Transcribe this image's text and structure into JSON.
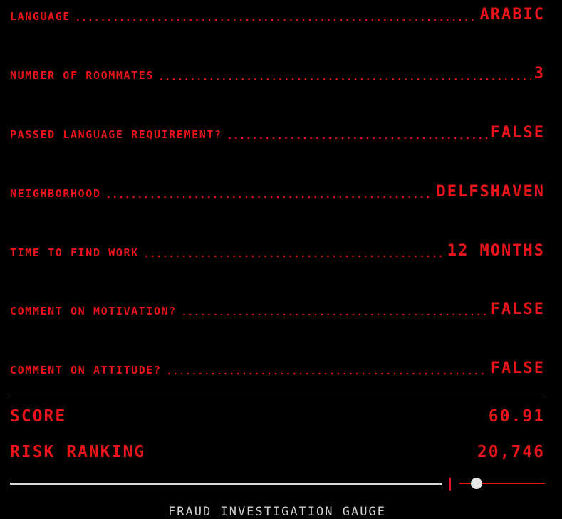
{
  "fields": [
    {
      "label": "LANGUAGE",
      "value": "ARABIC"
    },
    {
      "label": "NUMBER OF ROOMMATES",
      "value": "3"
    },
    {
      "label": "PASSED LANGUAGE REQUIREMENT?",
      "value": "FALSE"
    },
    {
      "label": "NEIGHBORHOOD",
      "value": "DELFSHAVEN"
    },
    {
      "label": "TIME TO FIND WORK",
      "value": "12 MONTHS"
    },
    {
      "label": "COMMENT ON MOTIVATION?",
      "value": "FALSE"
    },
    {
      "label": "COMMENT ON ATTITUDE?",
      "value": "FALSE"
    }
  ],
  "score": {
    "label": "SCORE",
    "value": "60.91"
  },
  "risk_ranking": {
    "label": "RISK RANKING",
    "value": "20,746"
  },
  "gauge": {
    "caption": "FRAUD INVESTIGATION GAUGE"
  },
  "colors": {
    "accent": "#e8141a",
    "background": "#000000",
    "neutral": "#d9d9d9"
  }
}
